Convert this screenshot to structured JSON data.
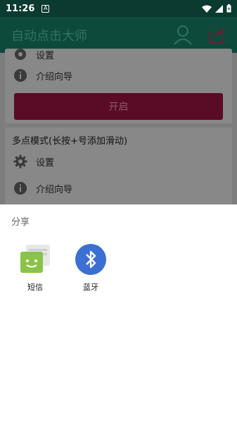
{
  "status_bar": {
    "time": "11:26",
    "notif_badge": "A"
  },
  "app_bar": {
    "title": "自动点击大师",
    "accent": "#0d4a3c"
  },
  "card1": {
    "setting_label": "设置",
    "guide_label": "介绍向导",
    "start_label": "开启"
  },
  "card2": {
    "title": "多点模式(长按+号添加滑动)",
    "setting_label": "设置",
    "guide_label": "介绍向导"
  },
  "share_sheet": {
    "title": "分享",
    "items": [
      {
        "label": "短信",
        "icon": "sms-app-icon"
      },
      {
        "label": "蓝牙",
        "icon": "bluetooth-icon"
      }
    ]
  }
}
